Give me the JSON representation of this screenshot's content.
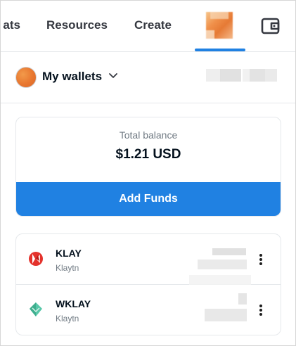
{
  "nav": {
    "partial_item": "ats",
    "resources": "Resources",
    "create": "Create",
    "active_color": "#2081e2"
  },
  "wallet_header": {
    "title": "My wallets",
    "avatar_color": "#e8762f"
  },
  "balance": {
    "label": "Total balance",
    "value": "$1.21 USD",
    "add_funds_label": "Add Funds",
    "button_color": "#2081e2"
  },
  "tokens": [
    {
      "symbol": "KLAY",
      "network": "Klaytn",
      "icon": "klay-token-icon"
    },
    {
      "symbol": "WKLAY",
      "network": "Klaytn",
      "icon": "wklay-token-icon"
    }
  ],
  "icons": {
    "wallet": "wallet-icon",
    "chevron": "chevron-down-icon",
    "more": "more-options-icon"
  }
}
